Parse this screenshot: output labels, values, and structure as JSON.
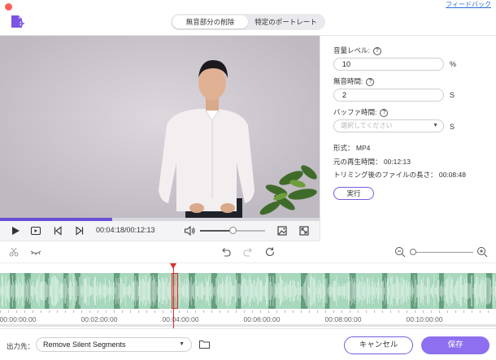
{
  "window": {
    "feedback_link": "フィードバック"
  },
  "tabs": [
    {
      "label": "無音部分の削除",
      "active": true
    },
    {
      "label": "特定のポートレート",
      "active": false
    }
  ],
  "player": {
    "timecode": "00:04:18/00:12:13",
    "progress_fraction": 0.35,
    "volume_fraction": 0.5
  },
  "settings": {
    "volume_level_label": "音量レベル:",
    "volume_level_value": "10",
    "volume_level_unit": "%",
    "silence_time_label": "無音時間:",
    "silence_time_value": "2",
    "silence_time_unit": "S",
    "buffer_time_label": "バッファ時間:",
    "buffer_time_placeholder": "選択してください",
    "buffer_time_unit": "S",
    "format_text": "形式： MP4",
    "original_duration_text": "元の再生時間： 00:12:13",
    "trimmed_length_text": "トリミング後のファイルの長さ： 00:08:48",
    "run_button": "実行"
  },
  "timeline": {
    "ticks": [
      "00:00:00:00",
      "00:02:00:00",
      "00:04:00:00",
      "00:06:00:00",
      "00:08:00:00",
      "00:10:00:00"
    ],
    "playhead_time": "00:04:18"
  },
  "bottom": {
    "output_label": "出力先：",
    "output_value": "Remove Silent Segments",
    "cancel_button": "キャンセル",
    "save_button": "保存"
  },
  "colors": {
    "accent": "#8e6ff0",
    "wave": "#a7d7bd",
    "playhead": "#d9302c"
  },
  "icons": [
    "add-media-icon",
    "play-icon",
    "snapshot-icon",
    "prev-frame-icon",
    "next-frame-icon",
    "volume-icon",
    "crop-icon",
    "fullscreen-icon",
    "scissors-icon",
    "eye-icon",
    "undo-icon",
    "redo-icon",
    "reset-icon",
    "zoom-out-icon",
    "zoom-in-icon",
    "help-icon",
    "folder-icon"
  ]
}
